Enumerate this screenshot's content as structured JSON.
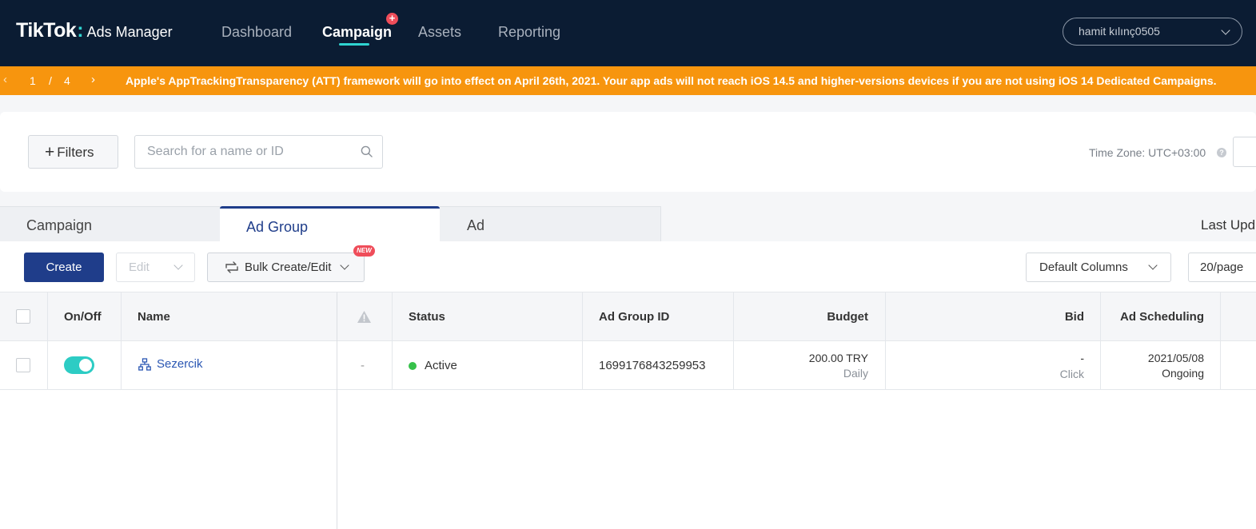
{
  "header": {
    "brand": "TikTok",
    "brand_colon": ":",
    "product": "Ads Manager",
    "nav": [
      {
        "label": "Dashboard"
      },
      {
        "label": "Campaign",
        "active": true,
        "badge": "+"
      },
      {
        "label": "Assets"
      },
      {
        "label": "Reporting"
      }
    ],
    "account": "hamit kılınç0505"
  },
  "banner": {
    "prev": "‹",
    "current": "1",
    "separator": "/",
    "total": "4",
    "next": "›",
    "message": "Apple's AppTrackingTransparency (ATT) framework will go into effect on April 26th, 2021. Your app ads will not reach iOS 14.5 and higher-versions devices if you are not using iOS 14 Dedicated Campaigns."
  },
  "filters": {
    "filters_label": "Filters",
    "search_placeholder": "Search for a name or ID",
    "timezone": "Time Zone: UTC+03:00",
    "help": "?"
  },
  "tabs": [
    {
      "label": "Campaign"
    },
    {
      "label": "Ad Group",
      "active": true
    },
    {
      "label": "Ad"
    }
  ],
  "last_updated": "Last Upd",
  "toolbar": {
    "create": "Create",
    "edit": "Edit",
    "bulk": "Bulk Create/Edit",
    "new_badge": "NEW",
    "columns": "Default Columns",
    "page_size": "20/page"
  },
  "table": {
    "headers": {
      "onoff": "On/Off",
      "name": "Name",
      "status": "Status",
      "adgroup_id": "Ad Group ID",
      "budget": "Budget",
      "bid": "Bid",
      "scheduling": "Ad Scheduling"
    },
    "rows": [
      {
        "enabled": true,
        "name": "Sezercik",
        "warning": "-",
        "status": "Active",
        "adgroup_id": "1699176843259953",
        "budget": "200.00 TRY",
        "budget_mode": "Daily",
        "bid": "-",
        "bid_type": "Click",
        "schedule_date": "2021/05/08",
        "schedule_state": "Ongoing"
      }
    ]
  },
  "colors": {
    "topbar": "#0b1c33",
    "accent": "#2fd3d0",
    "banner": "#f7950e",
    "primary": "#1f3d8a",
    "toggle_on": "#2dccc4",
    "status_active": "#36c14a",
    "badge": "#ef4d5a"
  }
}
